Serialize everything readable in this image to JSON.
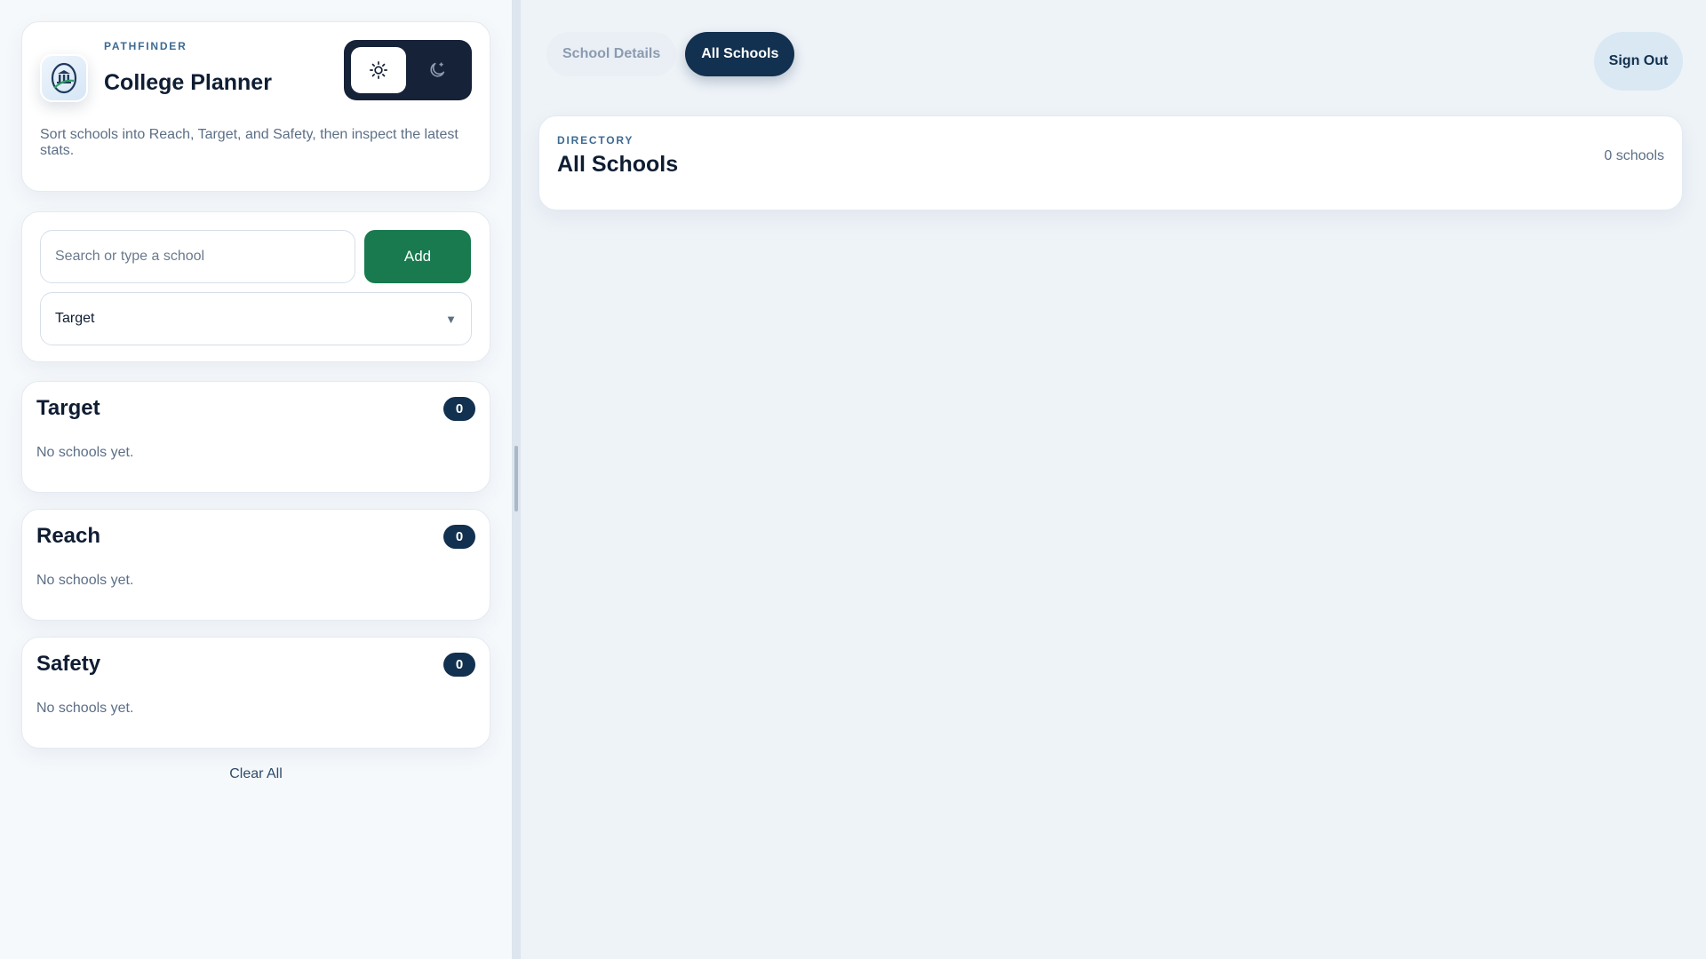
{
  "brand": {
    "eyebrow": "PATHFINDER",
    "title": "College Planner",
    "description": "Sort schools into Reach, Target, and Safety, then inspect the latest stats."
  },
  "theme_toggle": {
    "light_icon": "sun-icon",
    "dark_icon": "moon-icon",
    "active": "light"
  },
  "form": {
    "search_placeholder": "Search or type a school",
    "search_value": "",
    "add_label": "Add",
    "category_selected": "Target",
    "category_options": [
      "Target",
      "Reach",
      "Safety"
    ]
  },
  "buckets": [
    {
      "title": "Target",
      "count": "0",
      "empty_text": "No schools yet."
    },
    {
      "title": "Reach",
      "count": "0",
      "empty_text": "No schools yet."
    },
    {
      "title": "Safety",
      "count": "0",
      "empty_text": "No schools yet."
    }
  ],
  "clear_all_label": "Clear All",
  "tabs": [
    {
      "label": "School Details",
      "active": false
    },
    {
      "label": "All Schools",
      "active": true
    }
  ],
  "sign_out_label": "Sign Out",
  "directory": {
    "eyebrow": "DIRECTORY",
    "title": "All Schools",
    "count_text": "0 schools"
  },
  "colors": {
    "navy": "#12304f",
    "green": "#187a4e",
    "muted": "#5c6f86"
  }
}
